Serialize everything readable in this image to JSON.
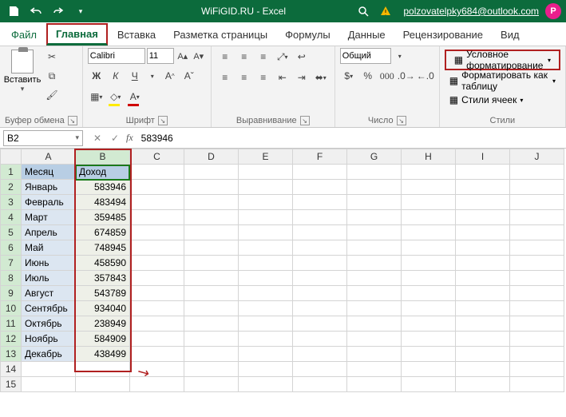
{
  "title_bar": {
    "doc_title": "WiFiGID.RU  -  Excel",
    "user_email": "polzovatelpky684@outlook.com",
    "avatar_letter": "P"
  },
  "tabs": {
    "file": "Файл",
    "home": "Главная",
    "insert": "Вставка",
    "layout": "Разметка страницы",
    "formulas": "Формулы",
    "data": "Данные",
    "review": "Рецензирование",
    "view": "Вид"
  },
  "ribbon": {
    "clipboard": {
      "paste": "Вставить",
      "label": "Буфер обмена"
    },
    "font": {
      "name": "Calibri",
      "size": "11",
      "bold": "Ж",
      "italic": "К",
      "underline": "Ч",
      "label": "Шрифт"
    },
    "align": {
      "label": "Выравнивание"
    },
    "number": {
      "format": "Общий",
      "label": "Число"
    },
    "styles": {
      "cond": "Условное форматирование",
      "table": "Форматировать как таблицу",
      "cell": "Стили ячеек",
      "label": "Стили"
    }
  },
  "name_box": "B2",
  "formula_value": "583946",
  "columns": [
    "A",
    "B",
    "C",
    "D",
    "E",
    "F",
    "G",
    "H",
    "I",
    "J"
  ],
  "headers": {
    "a": "Месяц",
    "b": "Доход"
  },
  "rows": [
    {
      "n": 1,
      "a": "",
      "b": ""
    },
    {
      "n": 2,
      "a": "Январь",
      "b": "583946"
    },
    {
      "n": 3,
      "a": "Февраль",
      "b": "483494"
    },
    {
      "n": 4,
      "a": "Март",
      "b": "359485"
    },
    {
      "n": 5,
      "a": "Апрель",
      "b": "674859"
    },
    {
      "n": 6,
      "a": "Май",
      "b": "748945"
    },
    {
      "n": 7,
      "a": "Июнь",
      "b": "458590"
    },
    {
      "n": 8,
      "a": "Июль",
      "b": "357843"
    },
    {
      "n": 9,
      "a": "Август",
      "b": "543789"
    },
    {
      "n": 10,
      "a": "Сентябрь",
      "b": "934040"
    },
    {
      "n": 11,
      "a": "Октябрь",
      "b": "238949"
    },
    {
      "n": 12,
      "a": "Ноябрь",
      "b": "584909"
    },
    {
      "n": 13,
      "a": "Декабрь",
      "b": "438499"
    },
    {
      "n": 14,
      "a": "",
      "b": ""
    },
    {
      "n": 15,
      "a": "",
      "b": ""
    }
  ]
}
